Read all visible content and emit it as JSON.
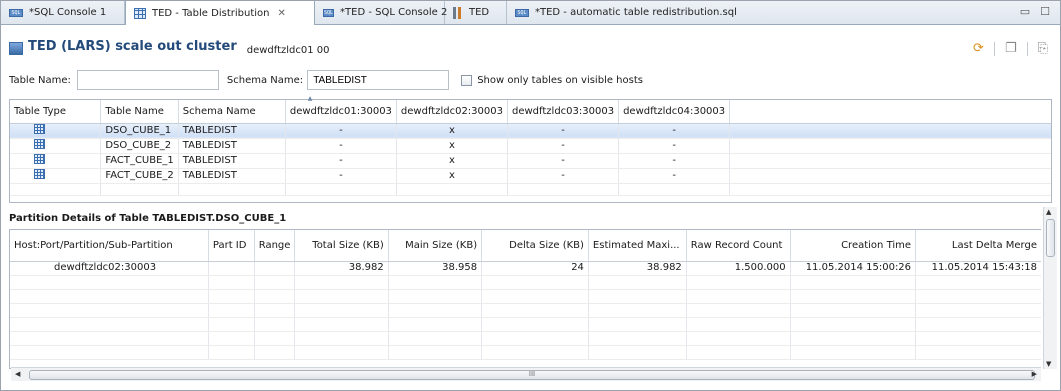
{
  "tabs": [
    {
      "label": "*SQL Console 1",
      "icon": "sql-console-icon"
    },
    {
      "label": "TED - Table Distribution",
      "icon": "table-icon",
      "active": true
    },
    {
      "label": "*TED - SQL Console 2",
      "icon": "sql-console-icon"
    },
    {
      "label": "TED",
      "icon": "ted-icon"
    },
    {
      "label": "*TED - automatic table redistribution.sql",
      "icon": "sql-file-icon"
    }
  ],
  "sql_badge": "SQL",
  "close_glyph": "✕",
  "header": {
    "title": "TED (LARS) scale out cluster",
    "host": "dewdftzldc01 00"
  },
  "filters": {
    "table_name_label": "Table Name:",
    "table_name_value": "",
    "schema_name_label": "Schema Name:",
    "schema_name_value": "TABLEDIST",
    "visible_hosts_label": "Show only tables on visible hosts"
  },
  "dist_table": {
    "columns": [
      "Table Type",
      "Table Name",
      "Schema Name",
      "dewdftzldc01:30003",
      "dewdftzldc02:30003",
      "dewdftzldc03:30003",
      "dewdftzldc04:30003"
    ],
    "rows": [
      {
        "table_name": "DSO_CUBE_1",
        "schema": "TABLEDIST",
        "h1": "-",
        "h2": "x",
        "h3": "-",
        "h4": "-"
      },
      {
        "table_name": "DSO_CUBE_2",
        "schema": "TABLEDIST",
        "h1": "-",
        "h2": "x",
        "h3": "-",
        "h4": "-"
      },
      {
        "table_name": "FACT_CUBE_1",
        "schema": "TABLEDIST",
        "h1": "-",
        "h2": "x",
        "h3": "-",
        "h4": "-"
      },
      {
        "table_name": "FACT_CUBE_2",
        "schema": "TABLEDIST",
        "h1": "-",
        "h2": "x",
        "h3": "-",
        "h4": "-"
      }
    ]
  },
  "partition": {
    "title": "Partition Details of Table TABLEDIST.DSO_CUBE_1",
    "columns": [
      "Host:Port/Partition/Sub-Partition",
      "Part ID",
      "Range",
      "Total Size (KB)",
      "Main Size (KB)",
      "Delta Size (KB)",
      "Estimated Maxi...",
      "Raw Record Count",
      "Creation Time",
      "Last Delta Merge"
    ],
    "rows": [
      {
        "host": "dewdftzldc02:30003",
        "part_id": "",
        "range": "",
        "total": "38.982",
        "main": "38.958",
        "delta": "24",
        "est_max": "38.982",
        "raw": "1.500.000",
        "created": "11.05.2014 15:00:26",
        "last_merge": "11.05.2014 15:43:18"
      }
    ]
  },
  "hscroll_grip": "III"
}
